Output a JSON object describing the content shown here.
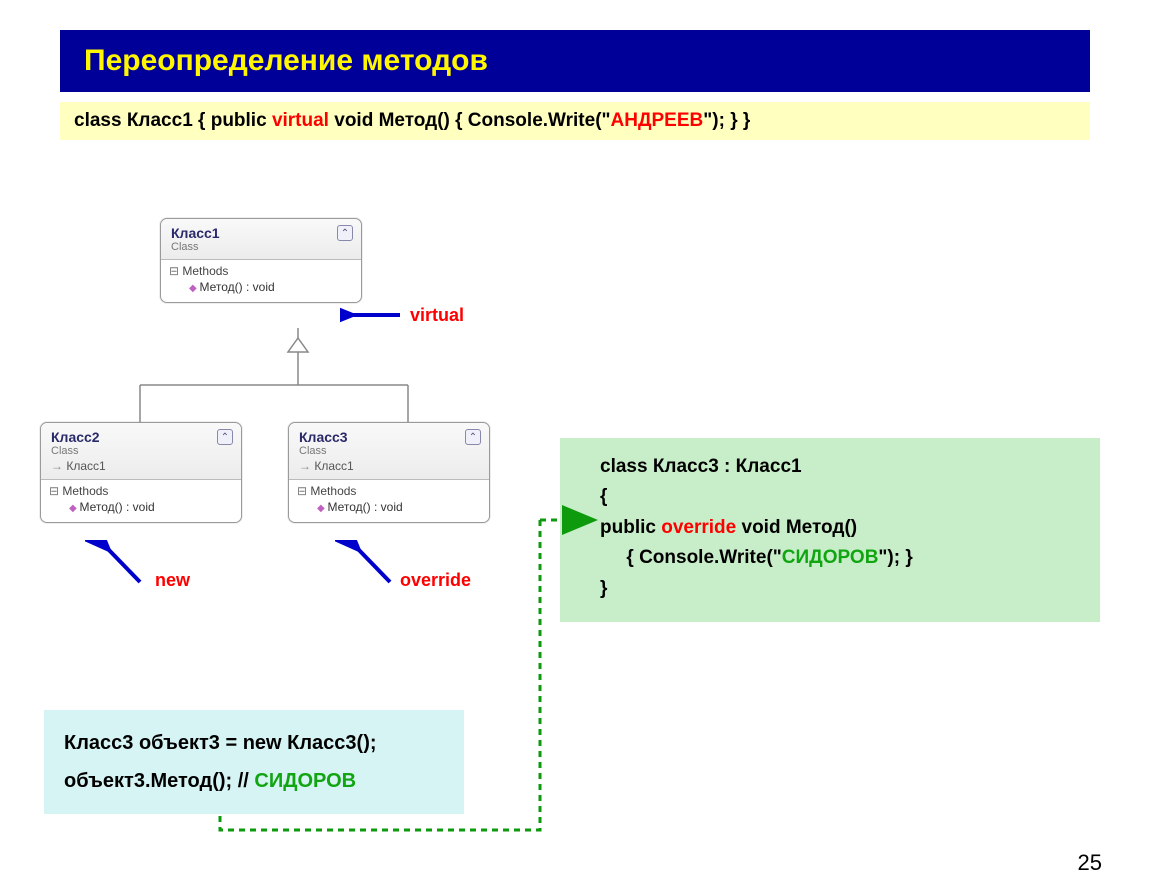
{
  "title": "Переопределение методов",
  "codeStrip": {
    "p1": "class Класс1   {    public ",
    "virtual": "virtual",
    "p2": " void Метод() { Console.Write(\"",
    "str": "АНДРЕЕВ",
    "p3": "\"); }    }"
  },
  "uml": {
    "class1": {
      "name": "Класс1",
      "type": "Class",
      "section": "Methods",
      "method": "Метод() : void"
    },
    "class2": {
      "name": "Класс2",
      "type": "Class",
      "base": "Класс1",
      "section": "Methods",
      "method": "Метод() : void"
    },
    "class3": {
      "name": "Класс3",
      "type": "Class",
      "base": "Класс1",
      "section": "Methods",
      "method": "Метод() : void"
    }
  },
  "labels": {
    "virtual": "virtual",
    "new": "new",
    "override": "override"
  },
  "greenCode": {
    "l1": "class Класс3 : Класс1",
    "l2": "{",
    "l3a": "public ",
    "l3ov": "override",
    "l3b": " void Метод()",
    "l4a": "     { Console.Write(\"",
    "l4s": "СИДОРОВ",
    "l4b": "\"); }",
    "l5": "}"
  },
  "cyanCode": {
    "l1": "Класс3 объект3 = new Класс3();",
    "l2a": "объект3.Метод();  // ",
    "l2b": "СИДОРОВ"
  },
  "pageNum": "25"
}
